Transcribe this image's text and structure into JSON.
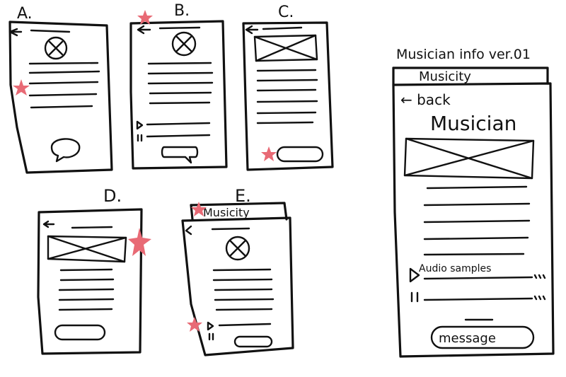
{
  "colors": {
    "ink": "#111111",
    "star": "#e86a75",
    "paper": "#ffffff"
  },
  "sketches": [
    {
      "label": "A."
    },
    {
      "label": "B."
    },
    {
      "label": "C."
    },
    {
      "label": "D."
    },
    {
      "label": "E.",
      "tab_label": "Musicity"
    }
  ],
  "final": {
    "title": "Musician info ver.01",
    "tab_label": "Musicity",
    "back_label": "← back",
    "heading": "Musician",
    "audio_label": "Audio samples",
    "message_label": "message"
  }
}
